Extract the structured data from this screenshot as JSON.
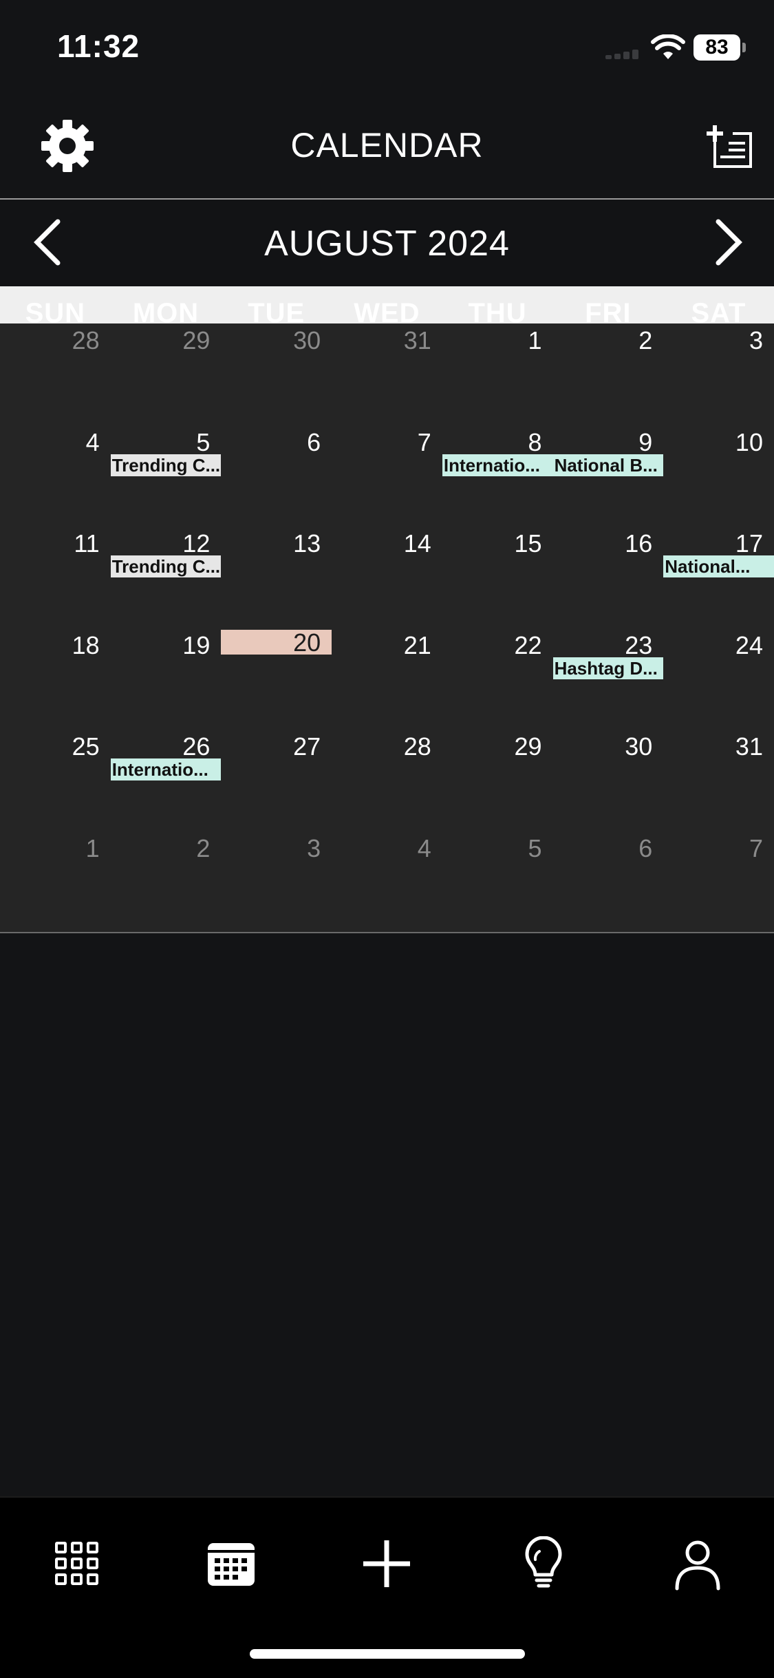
{
  "status_bar": {
    "time": "11:32",
    "battery": "83"
  },
  "header": {
    "title": "CALENDAR",
    "settings_icon": "gear-icon",
    "add_icon": "add-note-icon"
  },
  "month_nav": {
    "title": "AUGUST 2024",
    "prev_icon": "chevron-left-icon",
    "next_icon": "chevron-right-icon"
  },
  "weekdays": [
    "SUN",
    "MON",
    "TUE",
    "WED",
    "THU",
    "FRI",
    "SAT"
  ],
  "weeks": [
    [
      {
        "d": "28",
        "out": true
      },
      {
        "d": "29",
        "out": true
      },
      {
        "d": "30",
        "out": true
      },
      {
        "d": "31",
        "out": true
      },
      {
        "d": "1"
      },
      {
        "d": "2"
      },
      {
        "d": "3"
      }
    ],
    [
      {
        "d": "4"
      },
      {
        "d": "5",
        "event": "Trending C...",
        "event_color": "grey"
      },
      {
        "d": "6"
      },
      {
        "d": "7"
      },
      {
        "d": "8",
        "event": "Internatio..."
      },
      {
        "d": "9",
        "event": "National B..."
      },
      {
        "d": "10"
      }
    ],
    [
      {
        "d": "11"
      },
      {
        "d": "12",
        "event": "Trending C...",
        "event_color": "grey"
      },
      {
        "d": "13"
      },
      {
        "d": "14"
      },
      {
        "d": "15"
      },
      {
        "d": "16"
      },
      {
        "d": "17",
        "event": "National..."
      }
    ],
    [
      {
        "d": "18"
      },
      {
        "d": "19"
      },
      {
        "d": "20",
        "today": true
      },
      {
        "d": "21"
      },
      {
        "d": "22"
      },
      {
        "d": "23",
        "event": "Hashtag D..."
      },
      {
        "d": "24"
      }
    ],
    [
      {
        "d": "25"
      },
      {
        "d": "26",
        "event": "Internatio..."
      },
      {
        "d": "27"
      },
      {
        "d": "28"
      },
      {
        "d": "29"
      },
      {
        "d": "30"
      },
      {
        "d": "31"
      }
    ],
    [
      {
        "d": "1",
        "out": true
      },
      {
        "d": "2",
        "out": true
      },
      {
        "d": "3",
        "out": true
      },
      {
        "d": "4",
        "out": true
      },
      {
        "d": "5",
        "out": true
      },
      {
        "d": "6",
        "out": true
      },
      {
        "d": "7",
        "out": true
      }
    ]
  ],
  "colors": {
    "today": "#e9c9bc",
    "event": "#c9efe6",
    "event_grey": "#e6e6e6",
    "grid_bg": "#252525"
  },
  "tabbar": {
    "icons": [
      "grid-icon",
      "calendar-icon",
      "plus-icon",
      "lightbulb-icon",
      "profile-icon"
    ]
  }
}
